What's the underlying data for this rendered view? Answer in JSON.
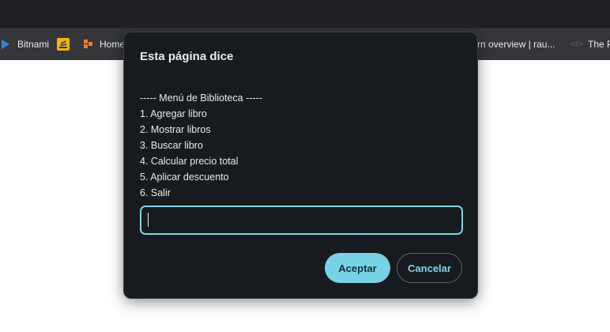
{
  "bookmarks": [
    {
      "label": "Bitnami",
      "icon": "bitnami-icon"
    },
    {
      "label": "",
      "icon": "stack-overflow-icon"
    },
    {
      "label": "Home",
      "icon": "home-bookmark-icon"
    },
    {
      "label": "rn overview | rau...",
      "icon": ""
    },
    {
      "label": "The P",
      "icon": "code-icon"
    }
  ],
  "dialog": {
    "title": "Esta página dice",
    "menu_lines": [
      "----- Menú de Biblioteca -----",
      "1. Agregar libro",
      "2. Mostrar libros",
      "3. Buscar libro",
      "4. Calcular precio total",
      "5. Aplicar descuento",
      "6. Salir"
    ],
    "input_value": "",
    "accept_label": "Aceptar",
    "cancel_label": "Cancelar"
  },
  "colors": {
    "dialog_bg": "#171b1f",
    "accent": "#78d3e6",
    "bookmark_bar": "#35363a"
  }
}
